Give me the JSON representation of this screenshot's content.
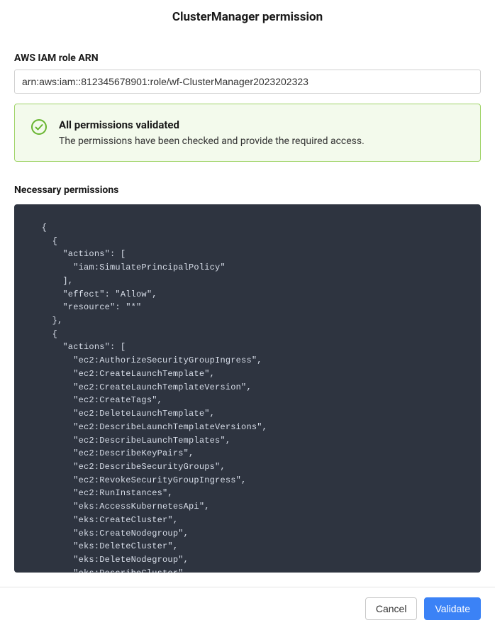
{
  "header": {
    "title": "ClusterManager permission"
  },
  "form": {
    "arn_label": "AWS IAM role ARN",
    "arn_value": "arn:aws:iam::812345678901:role/wf-ClusterManager2023202323"
  },
  "alert": {
    "title": "All permissions validated",
    "description": "The permissions have been checked and provide the required access."
  },
  "permissions": {
    "label": "Necessary permissions",
    "code": "  {\n    {\n      \"actions\": [\n        \"iam:SimulatePrincipalPolicy\"\n      ],\n      \"effect\": \"Allow\",\n      \"resource\": \"*\"\n    },\n    {\n      \"actions\": [\n        \"ec2:AuthorizeSecurityGroupIngress\",\n        \"ec2:CreateLaunchTemplate\",\n        \"ec2:CreateLaunchTemplateVersion\",\n        \"ec2:CreateTags\",\n        \"ec2:DeleteLaunchTemplate\",\n        \"ec2:DescribeLaunchTemplateVersions\",\n        \"ec2:DescribeLaunchTemplates\",\n        \"ec2:DescribeKeyPairs\",\n        \"ec2:DescribeSecurityGroups\",\n        \"ec2:RevokeSecurityGroupIngress\",\n        \"ec2:RunInstances\",\n        \"eks:AccessKubernetesApi\",\n        \"eks:CreateCluster\",\n        \"eks:CreateNodegroup\",\n        \"eks:DeleteCluster\",\n        \"eks:DeleteNodegroup\",\n        \"eks:DescribeCluster\",\n        \"eks:DescribeNodegroup\","
  },
  "footer": {
    "cancel_label": "Cancel",
    "validate_label": "Validate"
  }
}
